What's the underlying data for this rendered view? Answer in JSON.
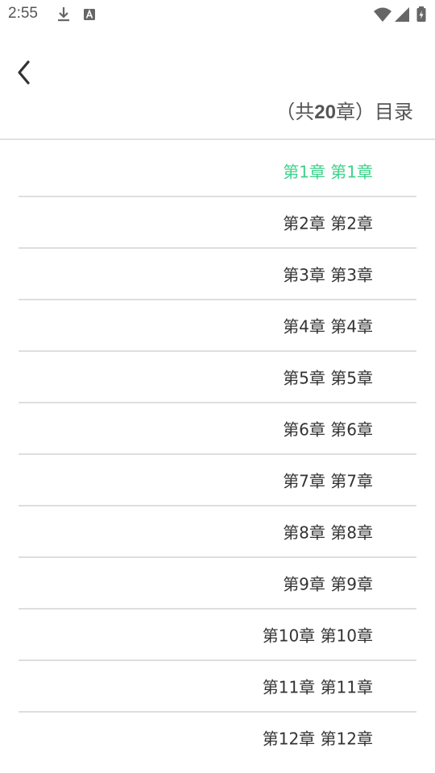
{
  "status_bar": {
    "time": "2:55",
    "icons": [
      "download-icon",
      "a-notification-icon",
      "wifi-icon",
      "signal-icon",
      "battery-charging-icon"
    ]
  },
  "header": {
    "back_icon": "chevron-left-icon",
    "title_prefix": "（共",
    "title_count": "20",
    "title_suffix": "章）目录"
  },
  "chapters": [
    {
      "label": "第1章 第1章",
      "active": true
    },
    {
      "label": "第2章 第2章",
      "active": false
    },
    {
      "label": "第3章 第3章",
      "active": false
    },
    {
      "label": "第4章 第4章",
      "active": false
    },
    {
      "label": "第5章 第5章",
      "active": false
    },
    {
      "label": "第6章 第6章",
      "active": false
    },
    {
      "label": "第7章 第7章",
      "active": false
    },
    {
      "label": "第8章 第8章",
      "active": false
    },
    {
      "label": "第9章 第9章",
      "active": false
    },
    {
      "label": "第10章 第10章",
      "active": false
    },
    {
      "label": "第11章 第11章",
      "active": false
    },
    {
      "label": "第12章 第12章",
      "active": false
    }
  ],
  "colors": {
    "active_chapter": "#3dd18a",
    "text": "#333333",
    "divider": "#dedede"
  }
}
